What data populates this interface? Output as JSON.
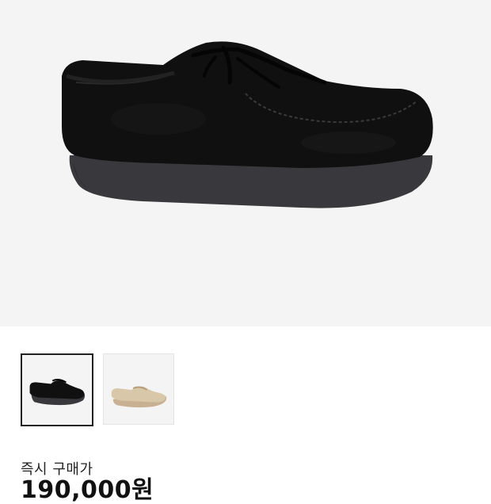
{
  "product": {
    "main_image_icon": "black-suede-moccasin-shoe",
    "thumbnails": [
      {
        "icon": "black-suede-shoe-thumbnail",
        "selected": true
      },
      {
        "icon": "beige-suede-shoe-thumbnail",
        "selected": false
      }
    ]
  },
  "price": {
    "label": "즉시 구매가",
    "value": "190,000원"
  },
  "colors": {
    "hero_background": "#f4f4f4",
    "shoe_upper": "#101010",
    "shoe_sole": "#38383d",
    "thumb_beige": "#d8c7a8",
    "thumb_beige_sole": "#c8b193"
  }
}
